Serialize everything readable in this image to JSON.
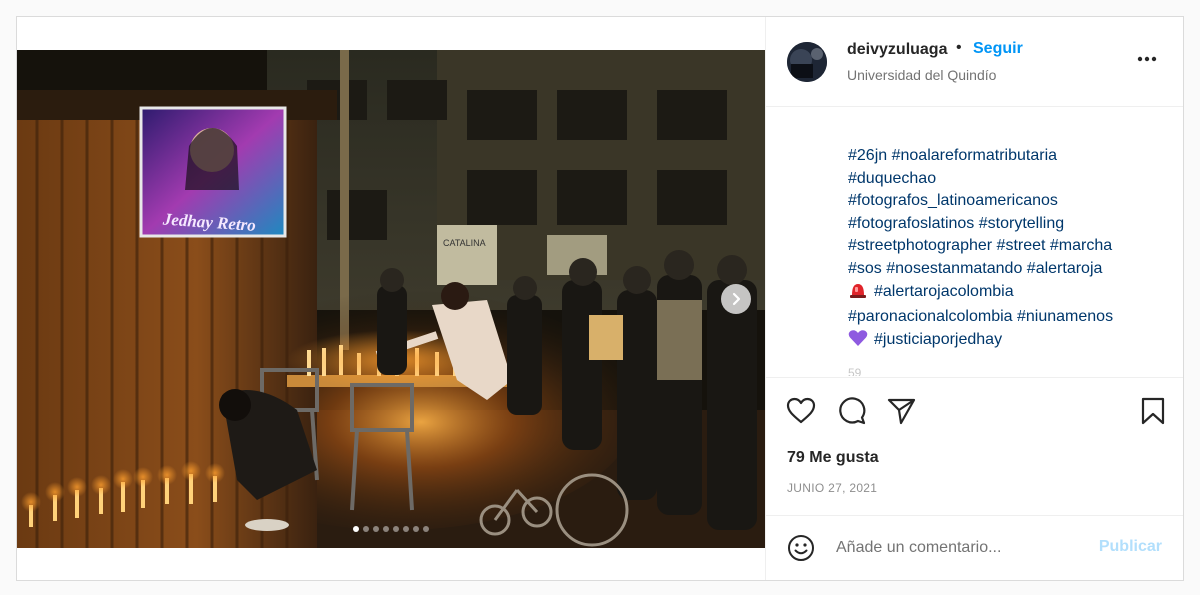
{
  "post": {
    "user": {
      "username": "deivyzuluaga",
      "follow_label": "Seguir",
      "location": "Universidad del Quindío",
      "separator": "•"
    },
    "media": {
      "banner_text": "Jedhay Retro",
      "sign_text": "CATALINA",
      "carousel_count": 8,
      "carousel_index": 0,
      "icons": [
        "chevron-right-icon"
      ]
    },
    "caption": {
      "lines": [
        "#26jn #noalareformatributaria",
        "#duquechao",
        "#fotografos_latinoamericanos",
        "#fotografoslatinos #storytelling",
        "#streetphotographer #street #marcha",
        "#sos #nosestanmatando #alertaroja",
        "#alertarojacolombia",
        "#paronacionalcolombia #niunamenos",
        "#justiciaporjedhay"
      ],
      "truncated_text": "59"
    },
    "actions": {
      "icons": [
        "heart-icon",
        "comment-icon",
        "share-icon",
        "bookmark-icon"
      ]
    },
    "likes_text": "79 Me gusta",
    "date_text": "JUNIO 27, 2021",
    "comment": {
      "placeholder": "Añade un comentario...",
      "publish_label": "Publicar",
      "emoji_icon": "smiley-icon"
    }
  },
  "colors": {
    "link": "#00376b",
    "follow": "#0095f6",
    "publish_disabled": "#b2dffc",
    "border": "#dbdbdb",
    "background": "#fafafa",
    "siren": "#e0242a",
    "heart_purple": "#8e5ae0"
  }
}
